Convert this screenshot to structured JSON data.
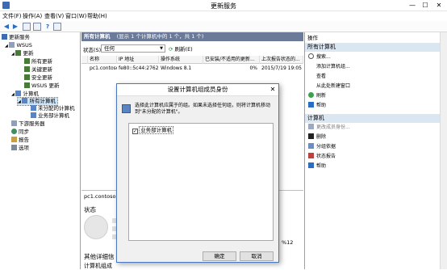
{
  "window": {
    "title": "更新服务",
    "min": "—",
    "max": "☐",
    "close": "✕"
  },
  "menu": [
    "文件(F)",
    "操作(A)",
    "查看(V)",
    "窗口(W)",
    "帮助(H)"
  ],
  "tree": {
    "root": "更新服务",
    "server": "WSUS",
    "updates": "更新",
    "all_updates": "所有更新",
    "critical": "关键更新",
    "security": "安全更新",
    "wsus_updates": "WSUS 更新",
    "computers": "计算机",
    "all_computers": "所有计算机",
    "unassigned": "未分配的计算机",
    "business": "业务部计算机",
    "downstream": "下游服务器",
    "sync": "同步",
    "reports": "报告",
    "options": "选项"
  },
  "center": {
    "header_title": "所有计算机",
    "header_info": "(显示 1 个计算机中的 1 个，共 1 个)",
    "status_label": "状态(S):",
    "status_value": "任何",
    "refresh": "刷新(E)",
    "columns": [
      "名称",
      "IP 地址",
      "操作系统",
      "已安装/不适用的更新...",
      "上次报告状态的..."
    ],
    "row": [
      "pc1.contoso....",
      "fe80::5c44:2762...",
      "Windows 8.1",
      "0%",
      "2015/7/19 19:05"
    ],
    "detail_title": "pc1.contoso.co",
    "detail_status": "状态",
    "detail_other": "其他详细信",
    "detail_group": "计算机组成",
    "detail_pct": "%12"
  },
  "actions": {
    "header": "操作",
    "section1": "所有计算机",
    "items1": [
      "搜索...",
      "添加计算机组...",
      "查看",
      "从此处新建窗口",
      "刷新",
      "帮助"
    ],
    "section2": "计算机",
    "items2": [
      "更改成员身份...",
      "删除",
      "分组依据",
      "状态报告",
      "帮助"
    ]
  },
  "dialog": {
    "title": "设置计算机组成员身份",
    "close": "✕",
    "message": "选择此计算机应属于的组。如果未选择任何组，则将计算机移动到\"未分配的计算机\"。",
    "group": "业务部计算机",
    "ok": "确定",
    "cancel": "取消"
  }
}
